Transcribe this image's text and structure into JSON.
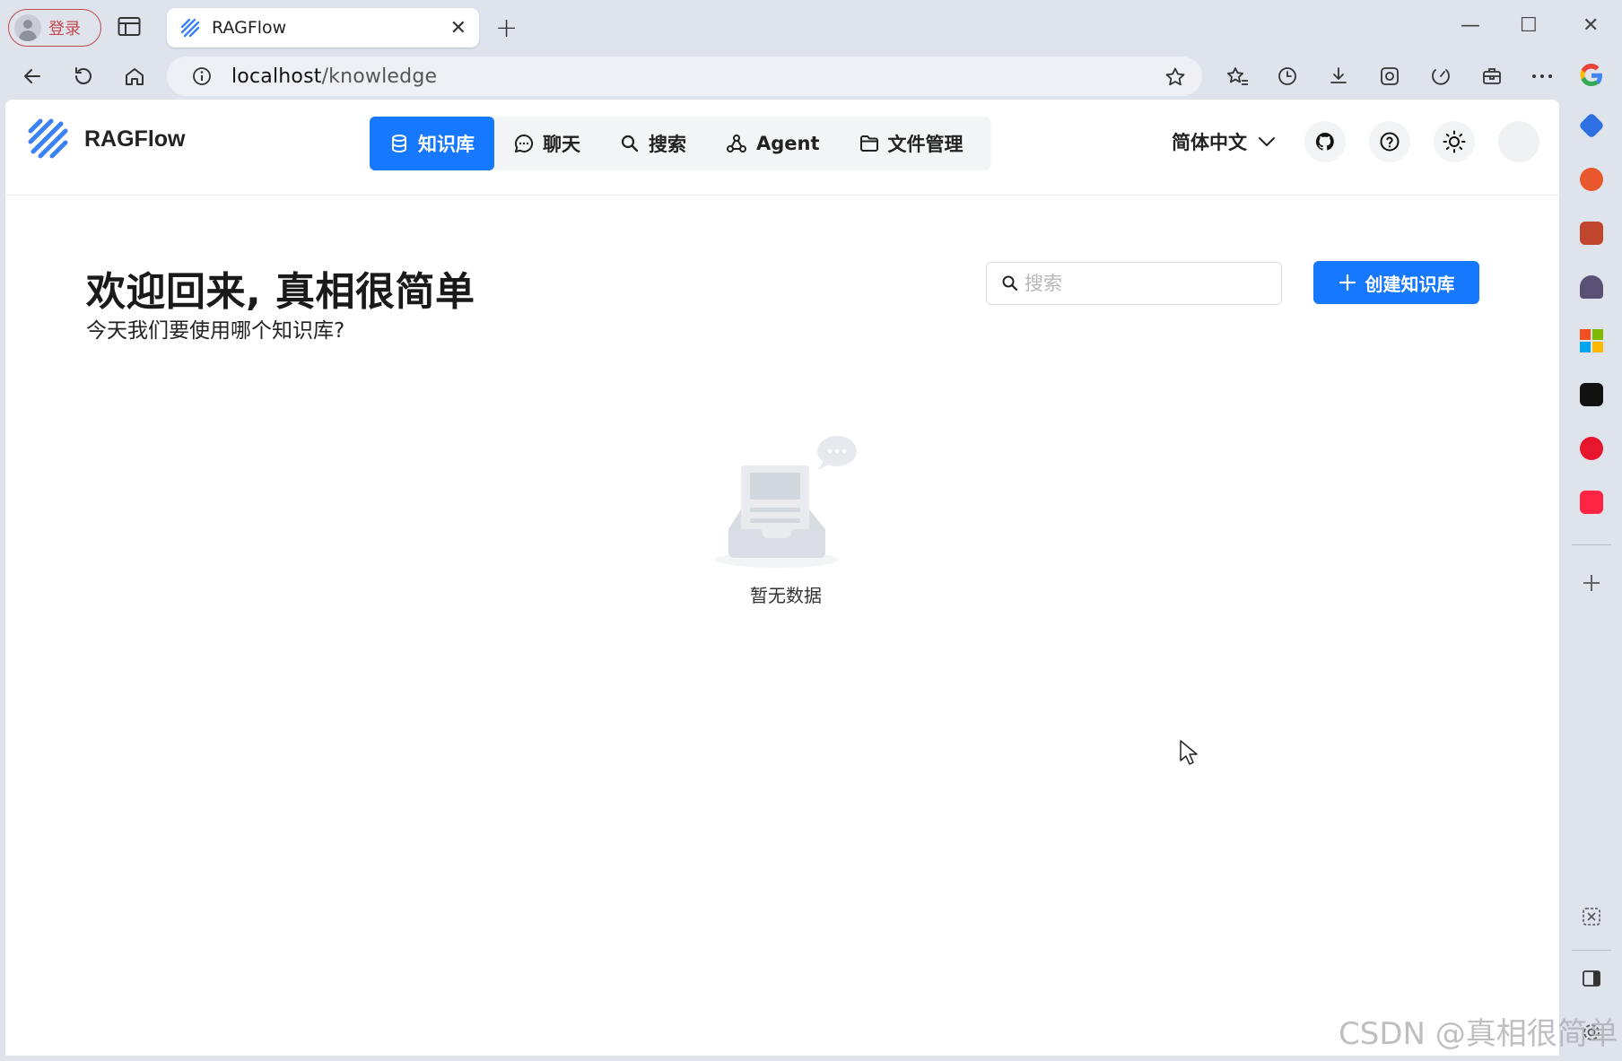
{
  "browser": {
    "profile_label": "登录",
    "tab_title": "RAGFlow",
    "tab_close": "✕",
    "new_tab": "+",
    "url_host": "localhost",
    "url_path": "/knowledge",
    "window_controls": {
      "minimize": "—",
      "maximize": "☐",
      "close": "✕"
    }
  },
  "app": {
    "logo_text": "RAGFlow",
    "nav": [
      {
        "label": "知识库",
        "icon": "database-icon",
        "active": true
      },
      {
        "label": "聊天",
        "icon": "chat-icon",
        "active": false
      },
      {
        "label": "搜索",
        "icon": "search-icon",
        "active": false
      },
      {
        "label": "Agent",
        "icon": "agent-icon",
        "active": false
      },
      {
        "label": "文件管理",
        "icon": "folder-icon",
        "active": false
      }
    ],
    "language": "简体中文"
  },
  "page": {
    "title": "欢迎回来, 真相很简单",
    "subtitle": "今天我们要使用哪个知识库?",
    "search_placeholder": "搜索",
    "create_button": "创建知识库",
    "empty_text": "暂无数据"
  },
  "watermark": "CSDN @真相很简单",
  "colors": {
    "primary": "#1677ff",
    "profile_accent": "#c4484f"
  }
}
